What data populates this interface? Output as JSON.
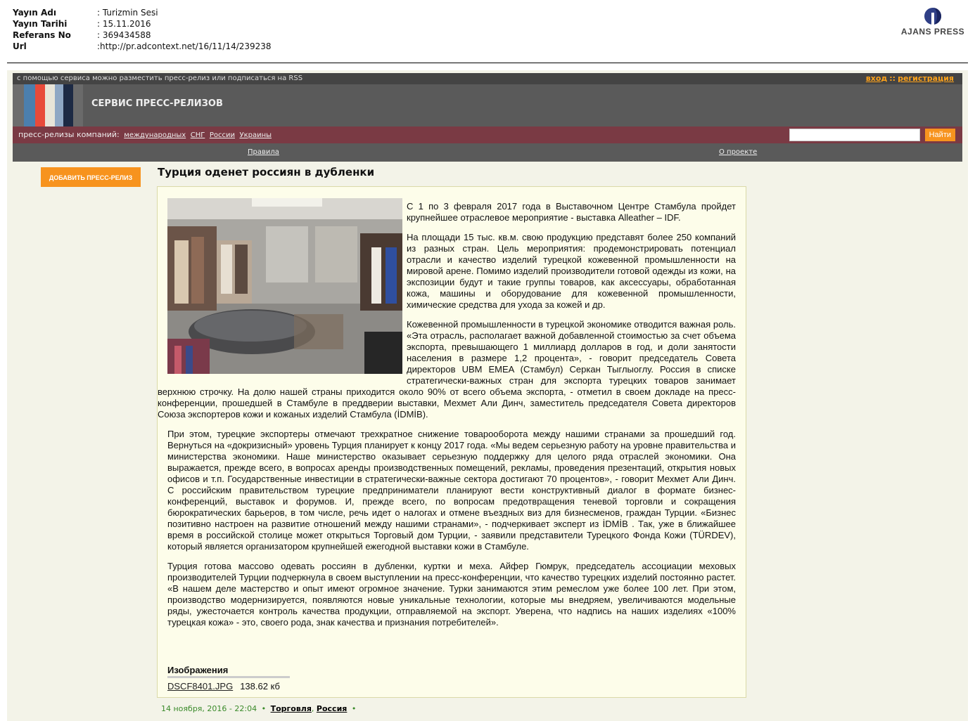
{
  "meta": {
    "rows": [
      {
        "key": "Yayın Adı",
        "value": ": Turizmin Sesi"
      },
      {
        "key": "Yayın Tarihi",
        "value": ": 15.11.2016"
      },
      {
        "key": "Referans No",
        "value": ": 369434588"
      },
      {
        "key": "Url",
        "value": ":http://pr.adcontext.net/16/11/14/239238"
      }
    ],
    "logo_text": "AJANS PRESS"
  },
  "site": {
    "top_strip": "с помощью сервиса можно разместить пресс-релиз или подписаться на RSS",
    "login": "вход",
    "auth_sep": "::",
    "register": "регистрация",
    "service_title": "СЕРВИС ПРЕСС-РЕЛИЗОВ",
    "company_label": "пресс-релизы компаний:",
    "company_links": [
      "международных",
      "СНГ",
      "России",
      "Украины"
    ],
    "search_button": "Найти",
    "search_placeholder": "",
    "rules_link": "Правила",
    "about_link": "О проекте",
    "add_button": "ДОБАВИТЬ ПРЕСС-РЕЛИЗ",
    "stripe_colors": [
      "#4b7fae",
      "#e84a3a",
      "#e8e4d8",
      "#8fa7c4",
      "#1d2a44"
    ]
  },
  "article": {
    "title": "Турция оденет россиян в дубленки",
    "paragraphs": [
      "С 1 по 3 февраля 2017 года в Выставочном Центре Стамбула пройдет крупнейшее отраслевое мероприятие - выставка Alleather – IDF.",
      "На площади 15 тыс. кв.м. свою продукцию представят более 250 компаний из разных стран. Цель мероприятия: продемонстрировать потенциал отрасли и качество изделий турецкой кожевенной промышленности на мировой арене. Помимо изделий производители готовой одежды из кожи, на экспозиции будут и такие группы товаров, как аксессуары, обработанная кожа, машины и оборудование для кожевенной промышленности, химические средства для ухода за кожей и др.",
      "Кожевенной промышленности в турецкой экономике отводится важная роль. «Эта отрасль, располагает важной добавленной стоимостью за счет объема экспорта, превышающего 1 миллиард долларов в год, и доли занятости населения в размере 1,2 процента», - говорит председатель Совета директоров UBM EMEA (Стамбул) Серкан Тыглыоглу. Россия в списке стратегически-важных стран для экспорта турецких товаров занимает верхнюю строчку. На долю нашей страны приходится около 90% от всего объема экспорта, - отметил в своем докладе на пресс-конференции, прошедшей в Стамбуле в преддверии выставки, Мехмет Али Динч, заместитель председателя Совета директоров Союза экспортеров кожи и кожаных изделий Стамбула (İDMİB).",
      "При этом, турецкие экспортеры отмечают трехкратное снижение товарооборота между нашими странами за прошедший год. Вернуться на «докризисный» уровень Турция планирует к концу 2017 года. «Мы ведем серьезную работу на уровне правительства и министерства экономики. Наше министерство оказывает серьезную поддержку для целого ряда отраслей экономики. Она выражается, прежде всего, в вопросах аренды производственных помещений, рекламы, проведения презентаций, открытия новых офисов и т.п. Государственные инвестиции в стратегически-важные сектора достигают 70 процентов», - говорит Мехмет Али Динч. С российским правительством турецкие предприниматели планируют вести конструктивный диалог в формате бизнес-конференций, выставок и форумов. И, прежде всего, по вопросам предотвращения теневой торговли и сокращения бюрократических барьеров, в том числе, речь идет о налогах и отмене въездных виз для бизнесменов, граждан Турции. «Бизнес позитивно настроен на развитие отношений между нашими странами», - подчеркивает эксперт из İDMİB . Так, уже в ближайшее время в российской столице может открыться Торговый дом Турции, - заявили представители Турецкого Фонда Кожи (TÜRDEV), который является организатором крупнейшей ежегодной выставки кожи в Стамбуле.",
      "Турция готова массово одевать россиян в дубленки, куртки и меха. Айфер Гюмрук, председатель ассоциации меховых производителей Турции подчеркнула в своем выступлении на пресс-конференции, что качество турецких изделий постоянно растет. «В нашем деле мастерство и опыт имеют огромное значение. Турки занимаются этим ремеслом уже более 100 лет. При этом, производство модернизируется, появляются новые уникальные технологии, которые мы внедряем, увеличиваются модельные ряды, ужесточается контроль качества продукции, отправляемой на экспорт. Уверена, что надпись на наших изделиях «100% турецкая кожа» - это, своего рода, знак качества и признания потребителей»."
    ],
    "images_heading": "Изображения",
    "file_name": "DSCF8401.JPG",
    "file_size": "138.62 кб"
  },
  "footer": {
    "date": "14 ноября, 2016 - 22:04",
    "dot": "•",
    "tag1": "Торговля",
    "comma": ",",
    "tag2": "Россия"
  }
}
